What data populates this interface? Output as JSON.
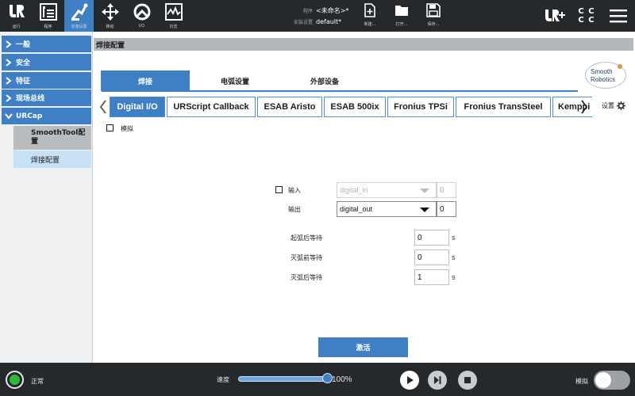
{
  "topbar": {
    "buttons": [
      {
        "label": "运行",
        "icon": "ur-logo-icon"
      },
      {
        "label": "程序",
        "icon": "program-icon"
      },
      {
        "label": "安装设置",
        "icon": "installation-icon",
        "active": true
      },
      {
        "label": "移动",
        "icon": "move-icon"
      },
      {
        "label": "I/O",
        "icon": "io-icon"
      },
      {
        "label": "日志",
        "icon": "log-icon"
      }
    ],
    "program_label": "程序",
    "program_value": "<未命名>*",
    "install_label": "安装设置",
    "install_value": "default*",
    "file_buttons": [
      {
        "label": "新建...",
        "icon": "new-file-icon"
      },
      {
        "label": "打开...",
        "icon": "open-folder-icon"
      },
      {
        "label": "保存...",
        "icon": "save-icon"
      }
    ],
    "right_icons": [
      "ur-plus-icon",
      "cc-icon",
      "hamburger-menu-icon"
    ],
    "cc_text": "C C"
  },
  "sidebar": {
    "items": [
      {
        "label": "一般"
      },
      {
        "label": "安全"
      },
      {
        "label": "特征"
      },
      {
        "label": "现场总线"
      },
      {
        "label": "URCap",
        "expanded": true
      }
    ],
    "subitems": [
      {
        "label": "SmoothTool配置"
      },
      {
        "label": "焊接配置",
        "selected": true
      }
    ]
  },
  "main": {
    "title": "焊接配置",
    "logo": {
      "line1": "Smooth",
      "line2": "Robotics"
    },
    "tabs": [
      {
        "label": "焊接",
        "active": true
      },
      {
        "label": "电弧设置"
      },
      {
        "label": "外部设备"
      }
    ],
    "subtabs": [
      {
        "label": "Digital I/O",
        "active": true
      },
      {
        "label": "URScript Callback"
      },
      {
        "label": "ESAB Aristo"
      },
      {
        "label": "ESAB 500ix"
      },
      {
        "label": "Fronius TPSi"
      },
      {
        "label": "Fronius TransSteel"
      },
      {
        "label": "Kemppi"
      }
    ],
    "settings_label": "设置",
    "simulate_label": "模拟",
    "input": {
      "label": "输入",
      "value": "digital_in",
      "number": "0"
    },
    "output": {
      "label": "输出",
      "value": "digital_out",
      "number": "0"
    },
    "waits": [
      {
        "label": "起弧后等待",
        "value": "0",
        "unit": "s"
      },
      {
        "label": "灭弧前等待",
        "value": "0",
        "unit": "s"
      },
      {
        "label": "灭弧后等待",
        "value": "1",
        "unit": "s"
      }
    ],
    "activate_label": "激活"
  },
  "bottombar": {
    "status_label": "正常",
    "speed_label": "速度",
    "speed_value": "100%",
    "speed_fraction": 1.0,
    "simulation_label": "模拟",
    "simulation_on": false,
    "status_color": "#2dbb3c",
    "accent": "#3f7fc3"
  }
}
